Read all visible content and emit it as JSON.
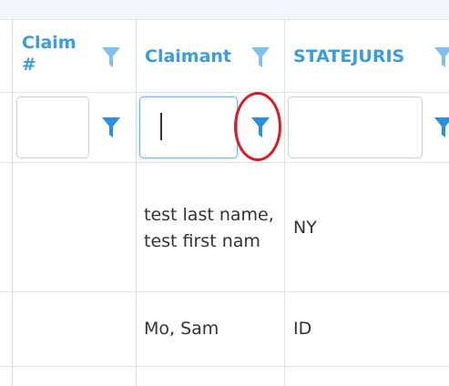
{
  "header": {
    "claim_number": "Claim #",
    "claimant": "Claimant",
    "statejuris": "STATEJURIS"
  },
  "filters": {
    "claim_number_value": "",
    "claimant_value": "",
    "statejuris_value": ""
  },
  "rows": [
    {
      "claimant": "test last name, test first nam",
      "statejuris": "NY"
    },
    {
      "claimant": "Mo, Sam",
      "statejuris": "ID"
    }
  ],
  "colors": {
    "accent": "#3b9ce0",
    "highlight_ring": "#e01a25"
  },
  "icons": {
    "column_filter": "funnel-icon"
  }
}
